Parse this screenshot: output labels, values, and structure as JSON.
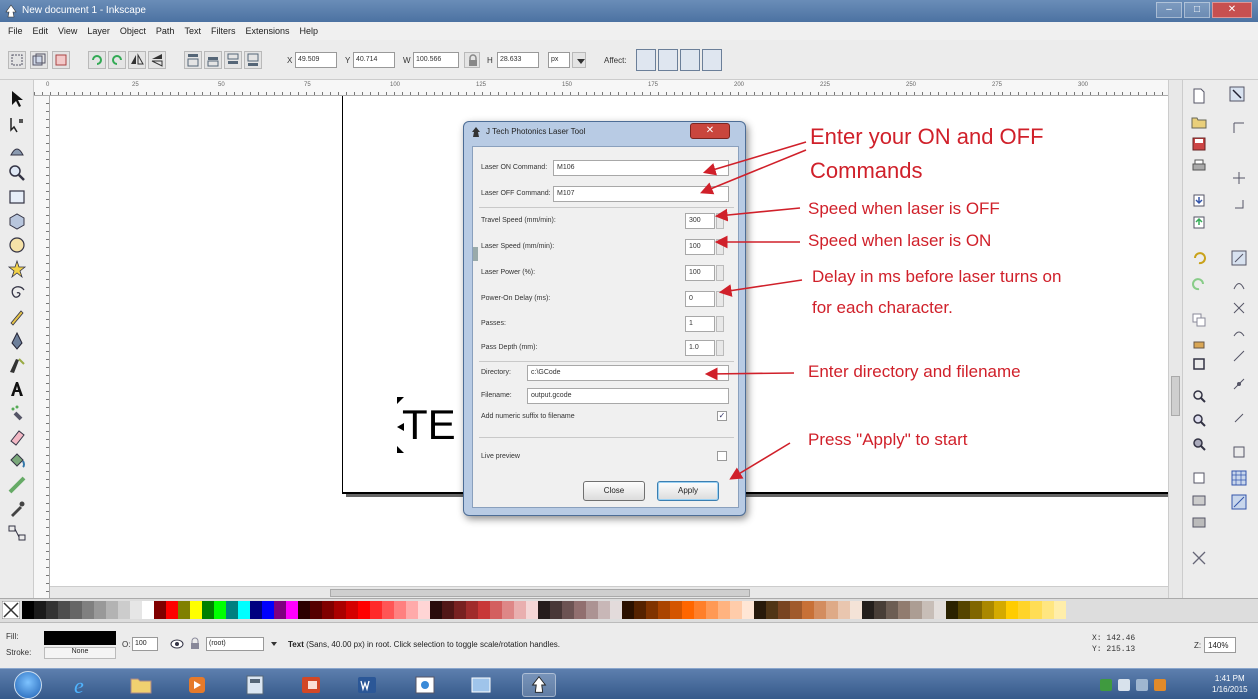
{
  "window": {
    "title": "New document 1 - Inkscape",
    "minimize": "–",
    "maximize": "□",
    "close": "✕"
  },
  "menu": [
    "File",
    "Edit",
    "View",
    "Layer",
    "Object",
    "Path",
    "Text",
    "Filters",
    "Extensions",
    "Help"
  ],
  "controls": {
    "x_label": "X",
    "x_value": "49.509",
    "y_label": "Y",
    "y_value": "40.714",
    "w_label": "W",
    "w_value": "100.566",
    "h_label": "H",
    "h_value": "28.633",
    "unit": "px",
    "affect_label": "Affect:"
  },
  "ruler_top": [
    "0",
    "25",
    "50",
    "75",
    "100",
    "125",
    "150",
    "175",
    "200",
    "225",
    "250",
    "275",
    "300"
  ],
  "canvas": {
    "text": "TE"
  },
  "dialog": {
    "title": "J Tech Photonics Laser Tool",
    "close": "✕",
    "fields": {
      "laser_on_label": "Laser ON Command:",
      "laser_on_value": "M106",
      "laser_off_label": "Laser OFF Command:",
      "laser_off_value": "M107",
      "travel_speed_label": "Travel Speed (mm/min):",
      "travel_speed_value": "300",
      "laser_speed_label": "Laser Speed (mm/min):",
      "laser_speed_value": "100",
      "laser_power_label": "Laser Power (%):",
      "laser_power_value": "100",
      "delay_label": "Power-On Delay (ms):",
      "delay_value": "0",
      "passes_label": "Passes:",
      "passes_value": "1",
      "pass_depth_label": "Pass Depth (mm):",
      "pass_depth_value": "1.0",
      "directory_label": "Directory:",
      "directory_value": "c:\\GCode",
      "filename_label": "Filename:",
      "filename_value": "output.gcode",
      "suffix_label": "Add numeric suffix to filename",
      "suffix_checked": "✓",
      "live_preview_label": "Live preview"
    },
    "buttons": {
      "close": "Close",
      "apply": "Apply"
    }
  },
  "annotations": {
    "on_off_line1": "Enter your ON and OFF",
    "on_off_line2": "Commands",
    "speed_off": "Speed when laser is OFF",
    "speed_on": "Speed when laser is ON",
    "delay_line1": "Delay in ms before laser turns on",
    "delay_line2": "for each character.",
    "directory": "Enter directory and filename",
    "apply": "Press \"Apply\" to start",
    "color": "#d0202a"
  },
  "status": {
    "fill_label": "Fill:",
    "stroke_label": "Stroke:",
    "stroke_value": "None",
    "opacity_label": "O:",
    "opacity_value": "100",
    "layer_value": "(root)",
    "message_bold": "Text",
    "message": " (Sans, 40.00 px) in root. Click selection to toggle scale/rotation handles.",
    "coord_x": "X: 142.46",
    "coord_y": "Y: 215.13",
    "zoom_label": "Z:",
    "zoom_value": "140%"
  },
  "taskbar": {
    "time": "1:41 PM",
    "date": "1/16/2015"
  }
}
